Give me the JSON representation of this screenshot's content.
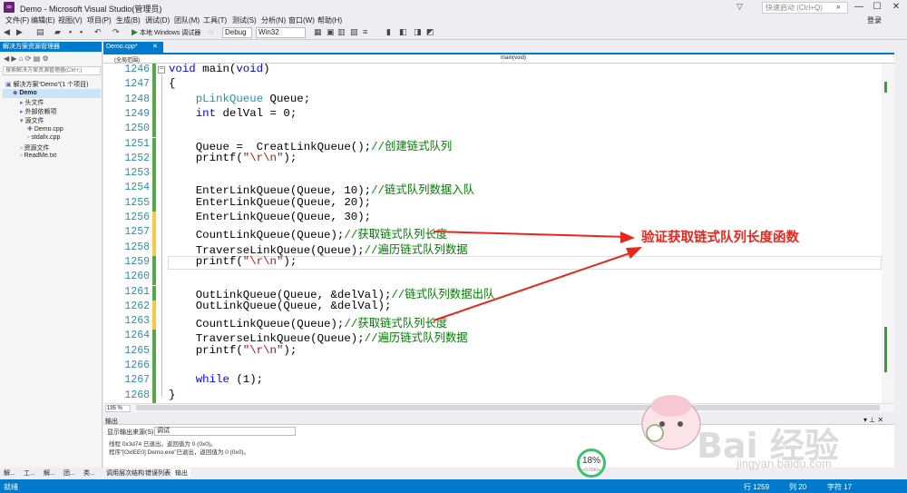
{
  "window": {
    "title": "Demo - Microsoft Visual Studio(管理员)",
    "quick_launch": "快速启动 (Ctrl+Q)",
    "login": "登录"
  },
  "menu": [
    "文件(F)",
    "编辑(E)",
    "视图(V)",
    "项目(P)",
    "生成(B)",
    "调试(D)",
    "团队(M)",
    "工具(T)",
    "测试(S)",
    "分析(N)",
    "窗口(W)",
    "帮助(H)"
  ],
  "toolbar": {
    "run_label": "本地 Windows 调试器",
    "config": "Debug",
    "platform": "Win32"
  },
  "solution_explorer": {
    "title": "解决方案资源管理器",
    "search_placeholder": "搜索解决方案资源管理器(Ctrl+;)",
    "items": [
      {
        "label": "解决方案“Demo”(1 个项目)",
        "indent": 0
      },
      {
        "label": "Demo",
        "indent": 1
      },
      {
        "label": "头文件",
        "indent": 2
      },
      {
        "label": "外部依赖项",
        "indent": 2
      },
      {
        "label": "源文件",
        "indent": 2
      },
      {
        "label": "Demo.cpp",
        "indent": 3
      },
      {
        "label": "stdafx.cpp",
        "indent": 3
      },
      {
        "label": "资源文件",
        "indent": 2
      },
      {
        "label": "ReadMe.txt",
        "indent": 2
      }
    ],
    "tabs": [
      "解...",
      "工...",
      "解...",
      "团...",
      "类..."
    ]
  },
  "editor": {
    "tab": "Demo.cpp*",
    "nav_scope": "(全局范围)",
    "nav_function": "main(void)",
    "zoom": "195 %",
    "lines": [
      {
        "n": "1246",
        "html": "<span class='kw'>void</span> main(<span class='kw'>void</span>)"
      },
      {
        "n": "1247",
        "html": "{"
      },
      {
        "n": "1248",
        "html": "    <span class='ty'>pLinkQueue</span> Queue;"
      },
      {
        "n": "1249",
        "html": "    <span class='kw'>int</span> delVal = 0;"
      },
      {
        "n": "1250",
        "html": ""
      },
      {
        "n": "1251",
        "html": "    Queue =  CreatLinkQueue();<span class='cm'>//创建链式队列</span>"
      },
      {
        "n": "1252",
        "html": "    printf(<span class='st'>\"\\r\\n\"</span>);"
      },
      {
        "n": "1253",
        "html": ""
      },
      {
        "n": "1254",
        "html": "    EnterLinkQueue(Queue, 10);<span class='cm'>//链式队列数据入队</span>"
      },
      {
        "n": "1255",
        "html": "    EnterLinkQueue(Queue, 20);"
      },
      {
        "n": "1256",
        "html": "    EnterLinkQueue(Queue, 30);"
      },
      {
        "n": "1257",
        "html": "    CountLinkQueue(Queue);<span class='cm'>//获取链式队列长度</span>"
      },
      {
        "n": "1258",
        "html": "    TraverseLinkQueue(Queue);<span class='cm'>//遍历链式队列数据</span>"
      },
      {
        "n": "1259",
        "html": "    printf(<span class='st'>\"\\r\\n\"</span>);"
      },
      {
        "n": "1260",
        "html": ""
      },
      {
        "n": "1261",
        "html": "    OutLinkQueue(Queue, &amp;delVal);<span class='cm'>//链式队列数据出队</span>"
      },
      {
        "n": "1262",
        "html": "    OutLinkQueue(Queue, &amp;delVal);"
      },
      {
        "n": "1263",
        "html": "    CountLinkQueue(Queue);<span class='cm'>//获取链式队列长度</span>"
      },
      {
        "n": "1264",
        "html": "    TraverseLinkQueue(Queue);<span class='cm'>//遍历链式队列数据</span>"
      },
      {
        "n": "1265",
        "html": "    printf(<span class='st'>\"\\r\\n\"</span>);"
      },
      {
        "n": "1266",
        "html": ""
      },
      {
        "n": "1267",
        "html": "    <span class='kw'>while</span> (1);"
      },
      {
        "n": "1268",
        "html": "}"
      }
    ]
  },
  "output": {
    "title": "输出",
    "source_label": "显示输出来源(S):",
    "source_value": "调试",
    "lines": [
      "线程 0x3d74 已退出，返回值为 0 (0x0)。",
      "程序“[OxlEE0] Demo.exe”已退出，返回值为 0 (0x0)。"
    ],
    "tabs": [
      "调用层次结构",
      "错误列表",
      "输出"
    ]
  },
  "status": {
    "ready": "就绪",
    "line": "行 1259",
    "col": "列 20",
    "char": "字符 17"
  },
  "annotation": {
    "text": "验证获取链式队列长度函数",
    "color": "#e8261c"
  },
  "overlay": {
    "percent": "18%",
    "speed": "+0.09K/s",
    "watermark": "Bai 经验",
    "watermark_url": "jingyan.baidu.com"
  }
}
